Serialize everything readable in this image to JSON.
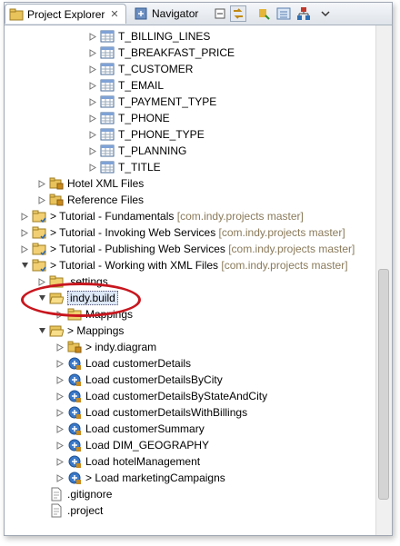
{
  "tabs": {
    "project_explorer": "Project Explorer",
    "navigator": "Navigator",
    "close_symbol": "✕"
  },
  "tree": {
    "tables": [
      "T_BILLING_LINES",
      "T_BREAKFAST_PRICE",
      "T_CUSTOMER",
      "T_EMAIL",
      "T_PAYMENT_TYPE",
      "T_PHONE",
      "T_PHONE_TYPE",
      "T_PLANNING",
      "T_TITLE"
    ],
    "hotel_xml_files": "Hotel XML Files",
    "reference_files": "Reference Files",
    "projects": [
      {
        "prefix": "> ",
        "name": "Tutorial - Fundamentals",
        "repo": "[com.indy.projects master]"
      },
      {
        "prefix": "> ",
        "name": "Tutorial - Invoking Web Services",
        "repo": "[com.indy.projects master]"
      },
      {
        "prefix": "> ",
        "name": "Tutorial - Publishing Web Services",
        "repo": "[com.indy.projects master]"
      },
      {
        "prefix": "> ",
        "name": "Tutorial - Working with XML Files",
        "repo": "[com.indy.projects master]"
      }
    ],
    "settings": ".settings",
    "indy_build": "indy.build",
    "mappings_child": "Mappings",
    "mappings_folder": "> Mappings",
    "indy_diagram": "> indy.diagram",
    "loads": [
      "Load customerDetails",
      "Load customerDetailsByCity",
      "Load customerDetailsByStateAndCity",
      "Load customerDetailsWithBillings",
      "Load customerSummary",
      "Load DIM_GEOGRAPHY",
      "Load hotelManagement",
      "> Load marketingCampaigns"
    ],
    "gitignore": ".gitignore",
    "project_file": ".project"
  },
  "colors": {
    "highlight_ellipse": "#c8161e",
    "decoration": "#8a7a5a"
  }
}
